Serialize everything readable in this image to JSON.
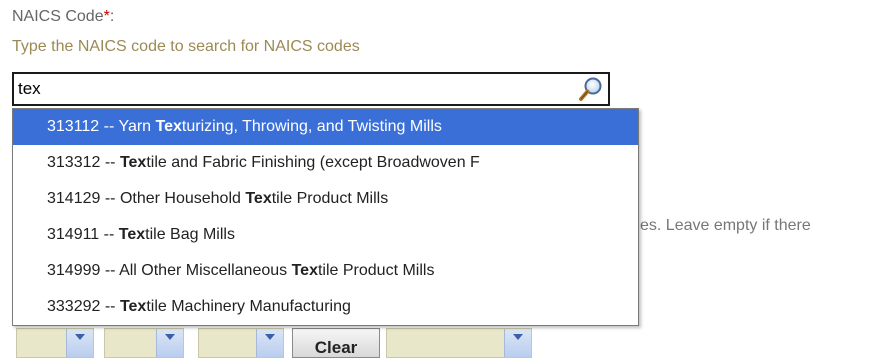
{
  "field": {
    "label": "NAICS Code",
    "required_marker": "*",
    "label_suffix": ":",
    "hint": "Type the NAICS code to search for NAICS codes"
  },
  "search": {
    "value": "tex",
    "icon": "magnifier-icon"
  },
  "suggestions": [
    {
      "code": "313112",
      "sep": " -- ",
      "pre": "Yarn ",
      "match": "Tex",
      "post": "turizing, Throwing, and Twisting Mills",
      "active": true
    },
    {
      "code": "313312",
      "sep": " -- ",
      "pre": "",
      "match": "Tex",
      "post": "tile and Fabric Finishing (except Broadwoven F",
      "active": false
    },
    {
      "code": "314129",
      "sep": " -- ",
      "pre": "Other Household ",
      "match": "Tex",
      "post": "tile Product Mills",
      "active": false
    },
    {
      "code": "314911",
      "sep": " -- ",
      "pre": "",
      "match": "Tex",
      "post": "tile Bag Mills",
      "active": false
    },
    {
      "code": "314999",
      "sep": " -- ",
      "pre": "All Other Miscellaneous ",
      "match": "Tex",
      "post": "tile Product Mills",
      "active": false
    },
    {
      "code": "333292",
      "sep": " -- ",
      "pre": "",
      "match": "Tex",
      "post": "tile Machinery Manufacturing",
      "active": false
    }
  ],
  "background": {
    "partial_text": "es. Leave empty if there"
  },
  "bottom": {
    "clear_label": "Clear"
  },
  "colors": {
    "highlight": "#3a6fd8",
    "hint": "#9c8a55",
    "required": "#cc0000"
  }
}
